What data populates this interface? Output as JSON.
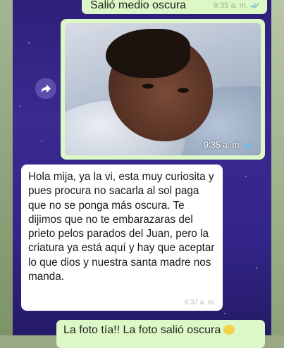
{
  "messages": {
    "top_outgoing": {
      "text": "Salió medio oscura",
      "time": "9:35 a. m."
    },
    "image_message": {
      "time": "9:35 a. m."
    },
    "incoming": {
      "text": "Hola mija, ya la vi, esta muy curiosita y pues procura no sacarla al sol paga que no se ponga más oscura. Te dijimos que no te embarazaras del prieto pelos parados del Juan, pero la criatura ya está aquí y hay que aceptar lo que dios y nuestra santa madre nos manda.",
      "time": "9:37 a. m."
    },
    "bottom_outgoing": {
      "text": "La foto tía!! La foto salió oscura"
    }
  },
  "icons": {
    "forward": "forward-arrow-icon",
    "read_receipt": "double-check-icon",
    "emoji": "smiling-face-emoji-icon"
  },
  "colors": {
    "background": "#33258a",
    "outgoing_bubble": "#dcf8c6",
    "incoming_bubble": "#ffffff",
    "read_check": "#4fc3f7"
  }
}
